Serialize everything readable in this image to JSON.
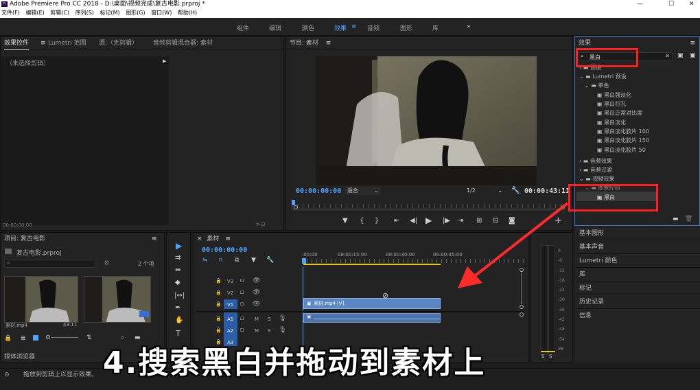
{
  "title_bar": {
    "icon": "Pr",
    "title": "Adobe Premiere Pro CC 2018 - D:\\桌面\\视频完成\\复古电影.prproj *",
    "minimize": "—",
    "maximize": "☐",
    "close": "✕"
  },
  "menu": [
    "文件(F)",
    "编辑(E)",
    "剪辑(C)",
    "序列(S)",
    "标记(M)",
    "图形(G)",
    "窗口(W)",
    "帮助(H)"
  ],
  "workspaces": [
    "组件",
    "编辑",
    "颜色",
    "效果",
    "音频",
    "图形",
    "库"
  ],
  "workspace_active": "效果",
  "workspace_more": "»",
  "left_panel": {
    "tabs": [
      "效果控件",
      "Lumetri 范围",
      "源:（无剪辑）",
      "音频剪辑混合器: 素材"
    ],
    "no_clip": "（未选择剪辑）",
    "timecode": "00:00:00:00"
  },
  "program": {
    "title": "节目: 素材",
    "current_tc": "00:00:00:00",
    "fit": "适合",
    "quality": "1/2",
    "duration_tc": "00:00:43:11"
  },
  "project": {
    "title": "项目: 复古电影",
    "file": "复古电影.prproj",
    "item_count": "2 个项",
    "items": [
      {
        "name": "素材.mp4",
        "dur": "43:11"
      },
      {
        "name": "",
        "dur": ""
      }
    ],
    "media_browser": "媒体浏览器"
  },
  "timeline": {
    "title": "素材",
    "current_tc": "00:00:00:00",
    "ruler": [
      ":00:00",
      "00:00:15:00",
      "00:00:30:00",
      "00:00:45:00"
    ],
    "tracks": [
      "V3",
      "V2",
      "V1",
      "A1",
      "A2",
      "A3"
    ],
    "clip_label": "素材.mp4 [V]",
    "track_buttons": [
      "M",
      "S"
    ]
  },
  "effects": {
    "title": "效果",
    "search": "黑白",
    "tree": [
      {
        "label": "预设",
        "indent": 0
      },
      {
        "label": "Lumetri 预设",
        "indent": 0
      },
      {
        "label": "单色",
        "indent": 1
      },
      {
        "label": "黑白强淡化",
        "indent": 2
      },
      {
        "label": "黑白打孔",
        "indent": 2
      },
      {
        "label": "黑白正常对比度",
        "indent": 2
      },
      {
        "label": "黑白淡化",
        "indent": 2
      },
      {
        "label": "黑白淡化胶片 100",
        "indent": 2
      },
      {
        "label": "黑白淡化胶片 150",
        "indent": 2
      },
      {
        "label": "黑白淡化胶片 50",
        "indent": 2
      },
      {
        "label": "音频效果",
        "indent": 0
      },
      {
        "label": "音频过渡",
        "indent": 0
      },
      {
        "label": "视频效果",
        "indent": 0
      },
      {
        "label": "图像控制",
        "indent": 1
      },
      {
        "label": "黑白",
        "indent": 2
      }
    ]
  },
  "side_panels": [
    "基本图形",
    "基本声音",
    "Lumetri 颜色",
    "库",
    "标记",
    "历史记录",
    "信息"
  ],
  "meter_scale": [
    "0",
    "-6",
    "-12",
    "-18",
    "-24",
    "-30",
    "-36",
    "-42",
    "-48",
    "-54",
    "dB"
  ],
  "meter_buttons": [
    "S",
    "S"
  ],
  "caption": "4.搜索黑白并拖动到素材上",
  "status": "拖放到剪辑上以显示效果。",
  "colors": {
    "accent": "#4fa3ff",
    "highlight": "#ff1f1f",
    "clip": "#5a86c4",
    "bg": "#232323"
  }
}
